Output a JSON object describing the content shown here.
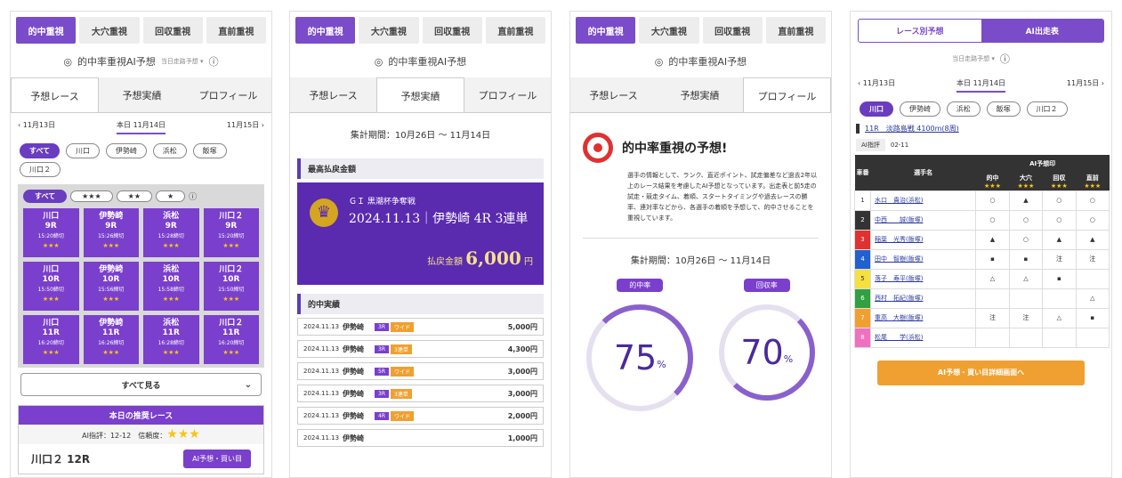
{
  "tabs": [
    "的中重視",
    "大穴重視",
    "回収重視",
    "直前重視"
  ],
  "ai_title": "的中率重視AI予想",
  "ai_select": "当日走路予想 ▾",
  "subtabs": [
    "予想レース",
    "予想実績",
    "プロフィール"
  ],
  "dates": {
    "prev": "11月13日",
    "today": "本日 11月14日",
    "next": "11月15日"
  },
  "venue_filters": [
    "すべて",
    "川口",
    "伊勢崎",
    "浜松",
    "飯塚",
    "川口２"
  ],
  "star_filters": [
    "すべて",
    "★★★",
    "★★",
    "★"
  ],
  "race_cards": [
    {
      "venue": "川口",
      "race": "9R",
      "time": "15:20締切"
    },
    {
      "venue": "伊勢崎",
      "race": "9R",
      "time": "15:26締切"
    },
    {
      "venue": "浜松",
      "race": "9R",
      "time": "15:28締切"
    },
    {
      "venue": "川口２",
      "race": "9R",
      "time": "15:20締切"
    },
    {
      "venue": "川口",
      "race": "10R",
      "time": "15:50締切"
    },
    {
      "venue": "伊勢崎",
      "race": "10R",
      "time": "15:56締切"
    },
    {
      "venue": "浜松",
      "race": "10R",
      "time": "15:58締切"
    },
    {
      "venue": "川口２",
      "race": "10R",
      "time": "15:50締切"
    },
    {
      "venue": "川口",
      "race": "11R",
      "time": "16:20締切"
    },
    {
      "venue": "伊勢崎",
      "race": "11R",
      "time": "16:26締切"
    },
    {
      "venue": "浜松",
      "race": "11R",
      "time": "16:28締切"
    },
    {
      "venue": "川口２",
      "race": "11R",
      "time": "16:20締切"
    }
  ],
  "card_stars": "★★★",
  "show_all": "すべて見る",
  "rec": {
    "header": "本日の推奨レース",
    "sub": "AI指評：12-12　信頼度：",
    "stars": "★★★",
    "venue": "川口２  12R",
    "button": "AI予想・買い目"
  },
  "period": "集計期間：10月26日 〜 11月14日",
  "max_payout_title": "最高払戻金額",
  "banner": {
    "line1": "ＧＩ 黒潮杯争奪戦",
    "line2": "2024.11.13｜伊勢崎 4R 3連単",
    "label": "払戻金額",
    "amount": "6,000",
    "unit": "円"
  },
  "hits_title": "的中実績",
  "hits": [
    {
      "date": "2024.11.13",
      "place": "伊勢崎",
      "race": "3R",
      "type": "ワイド",
      "amount": "5,000円"
    },
    {
      "date": "2024.11.13",
      "place": "伊勢崎",
      "race": "3R",
      "type": "3連単",
      "amount": "4,300円"
    },
    {
      "date": "2024.11.13",
      "place": "伊勢崎",
      "race": "5R",
      "type": "ワイド",
      "amount": "3,000円"
    },
    {
      "date": "2024.11.13",
      "place": "伊勢崎",
      "race": "3R",
      "type": "3連単",
      "amount": "3,000円"
    },
    {
      "date": "2024.11.13",
      "place": "伊勢崎",
      "race": "4R",
      "type": "ワイド",
      "amount": "2,000円"
    },
    {
      "date": "2024.11.13",
      "place": "伊勢崎",
      "race": "",
      "type": "",
      "amount": "1,000円"
    }
  ],
  "profile": {
    "heading": "的中率重視の予想!",
    "desc": "選手の情報として、ランク、直近ポイント、試走偏差など過去2年以上のレース結果を考慮したAI予想となっています。出走表と前5走の試走・競走タイム、着順、スタートタイミングや過去レースの勝率、連対率などから、各選手の着順を予想して、的中させることを重視しています。"
  },
  "rates": [
    {
      "label": "的中率",
      "value": "75",
      "unit": "%",
      "pct": 75
    },
    {
      "label": "回収率",
      "value": "70",
      "unit": "%",
      "pct": 70
    }
  ],
  "p4": {
    "top_tabs": [
      "レース別予想",
      "AI出走表"
    ],
    "select": "当日走路予想 ▾",
    "venues": [
      "川口",
      "伊勢崎",
      "浜松",
      "飯塚",
      "川口２"
    ],
    "race_link": "11R　淡路島戦 4100m(8周)",
    "ai_label": "AI指評",
    "ai_value": "02-11",
    "th_name": "選手名",
    "th_group": "AI予想印",
    "cols": [
      "的中",
      "大穴",
      "回収",
      "直前"
    ],
    "rows": [
      {
        "no": "1",
        "name": "水口　貴治(浜松)",
        "m": [
          "○",
          "▲",
          "○",
          "○"
        ],
        "color": "#ffffff"
      },
      {
        "no": "2",
        "name": "中西　　誠(飯塚)",
        "m": [
          "○",
          "○",
          "○",
          "○"
        ],
        "color": "#333333"
      },
      {
        "no": "3",
        "name": "稲葉　光秀(飯塚)",
        "m": [
          "▲",
          "○",
          "▲",
          "▲"
        ],
        "color": "#e03030"
      },
      {
        "no": "4",
        "name": "田中　智樹(飯塚)",
        "m": [
          "▪",
          "▪",
          "注",
          "注"
        ],
        "color": "#2060d0"
      },
      {
        "no": "5",
        "name": "落子　寿平(飯塚)",
        "m": [
          "△",
          "△",
          "▪",
          ""
        ],
        "color": "#f5e040"
      },
      {
        "no": "6",
        "name": "西村　拓紀(飯塚)",
        "m": [
          "",
          "",
          "",
          "△"
        ],
        "color": "#30a040"
      },
      {
        "no": "7",
        "name": "重高　大樹(飯塚)",
        "m": [
          "注",
          "注",
          "△",
          "▪"
        ],
        "color": "#f0a030"
      },
      {
        "no": "8",
        "name": "松尾　　学(浜松)",
        "m": [
          "",
          "",
          "",
          ""
        ],
        "color": "#f070c0"
      }
    ],
    "button": "AI予想・買い目詳細画面へ"
  }
}
